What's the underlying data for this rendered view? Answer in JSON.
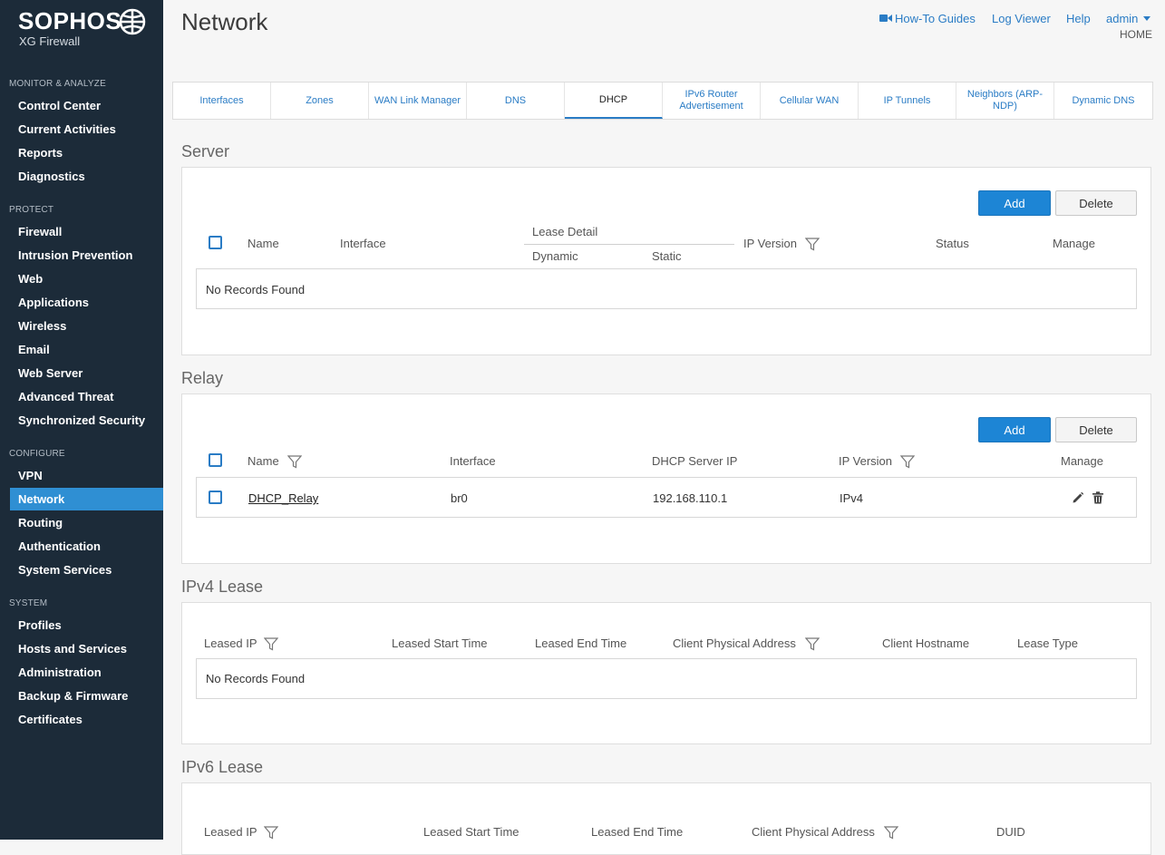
{
  "brand": {
    "name": "SOPHOS",
    "product": "XG Firewall"
  },
  "sidebar": {
    "sections": [
      {
        "label": "MONITOR & ANALYZE",
        "items": [
          "Control Center",
          "Current Activities",
          "Reports",
          "Diagnostics"
        ]
      },
      {
        "label": "PROTECT",
        "items": [
          "Firewall",
          "Intrusion Prevention",
          "Web",
          "Applications",
          "Wireless",
          "Email",
          "Web Server",
          "Advanced Threat",
          "Synchronized Security"
        ]
      },
      {
        "label": "CONFIGURE",
        "items": [
          "VPN",
          "Network",
          "Routing",
          "Authentication",
          "System Services"
        ]
      },
      {
        "label": "SYSTEM",
        "items": [
          "Profiles",
          "Hosts and Services",
          "Administration",
          "Backup & Firmware",
          "Certificates"
        ]
      }
    ],
    "active": "Network"
  },
  "header": {
    "title": "Network",
    "how_to": "How-To Guides",
    "log_viewer": "Log Viewer",
    "help": "Help",
    "user": "admin",
    "home": "HOME"
  },
  "tabs": [
    "Interfaces",
    "Zones",
    "WAN Link Manager",
    "DNS",
    "DHCP",
    "IPv6 Router Advertisement",
    "Cellular WAN",
    "IP Tunnels",
    "Neighbors (ARP-NDP)",
    "Dynamic DNS"
  ],
  "active_tab": "DHCP",
  "server": {
    "title": "Server",
    "add": "Add",
    "delete": "Delete",
    "cols": {
      "name": "Name",
      "interface": "Interface",
      "lease_detail": "Lease Detail",
      "dynamic": "Dynamic",
      "static": "Static",
      "ip_version": "IP Version",
      "status": "Status",
      "manage": "Manage"
    },
    "empty": "No Records Found"
  },
  "relay": {
    "title": "Relay",
    "add": "Add",
    "delete": "Delete",
    "cols": {
      "name": "Name",
      "interface": "Interface",
      "server_ip": "DHCP Server IP",
      "ip_version": "IP Version",
      "manage": "Manage"
    },
    "rows": [
      {
        "name": "DHCP_Relay",
        "interface": "br0",
        "server_ip": "192.168.110.1",
        "ip_version": "IPv4"
      }
    ]
  },
  "ipv4_lease": {
    "title": "IPv4 Lease",
    "cols": {
      "leased_ip": "Leased IP",
      "start": "Leased Start Time",
      "end": "Leased End Time",
      "mac": "Client Physical Address",
      "hostname": "Client Hostname",
      "type": "Lease Type"
    },
    "empty": "No Records Found"
  },
  "ipv6_lease": {
    "title": "IPv6 Lease",
    "cols": {
      "leased_ip": "Leased IP",
      "start": "Leased Start Time",
      "end": "Leased End Time",
      "mac": "Client Physical Address",
      "duid": "DUID"
    }
  },
  "colors": {
    "sidebar_bg": "#1c2b39",
    "active": "#2f8fd3",
    "link": "#2a7cc5",
    "add_btn": "#1d85d5"
  }
}
